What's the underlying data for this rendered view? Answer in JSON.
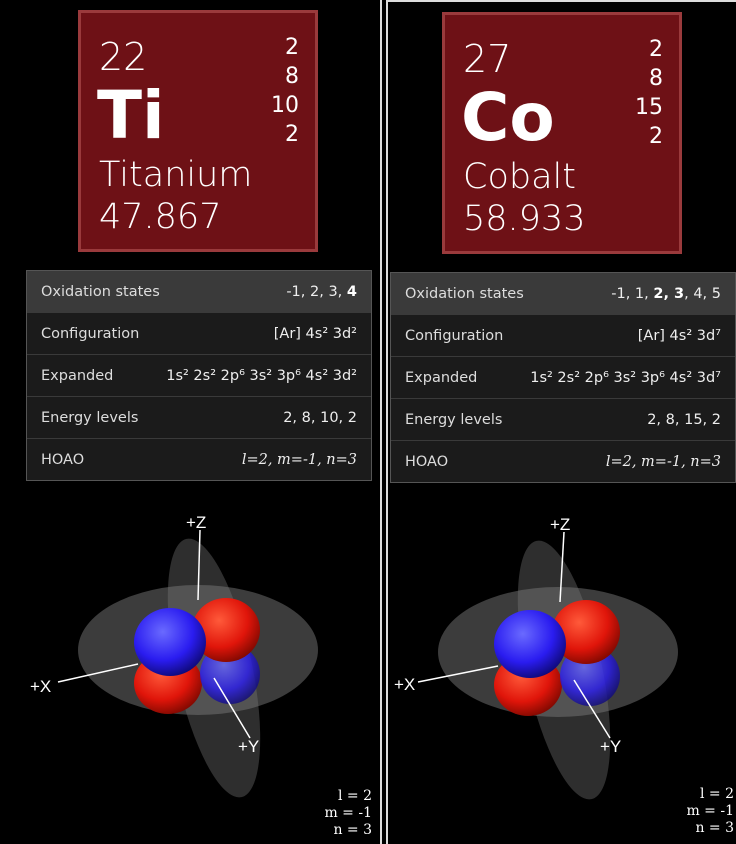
{
  "panels": [
    {
      "atomic_number": "22",
      "symbol": "Ti",
      "name": "Titanium",
      "mass": "47.867",
      "shells": [
        "2",
        "8",
        "10",
        "2"
      ],
      "rows": {
        "oxidation": {
          "label": "Oxidation states",
          "value_plain": "-1, 2, 3, ",
          "value_bold": "4",
          "value_tail": ""
        },
        "configuration": {
          "label": "Configuration",
          "value": "[Ar] 4s² 3d²"
        },
        "expanded": {
          "label": "Expanded",
          "value": "1s² 2s² 2p⁶ 3s² 3p⁶ 4s² 3d²"
        },
        "energy": {
          "label": "Energy levels",
          "value": "2, 8, 10, 2"
        },
        "hoao": {
          "label": "HOAO",
          "value": "l=2, m=-1, n=3"
        }
      },
      "axes": {
        "z": "+Z",
        "x": "+X",
        "y": "+Y"
      },
      "quantum": {
        "l": "l = 2",
        "m": "m = -1",
        "n": "n = 3"
      }
    },
    {
      "atomic_number": "27",
      "symbol": "Co",
      "name": "Cobalt",
      "mass": "58.933",
      "shells": [
        "2",
        "8",
        "15",
        "2"
      ],
      "rows": {
        "oxidation": {
          "label": "Oxidation states",
          "value_plain": "-1, 1, ",
          "value_bold": "2, 3",
          "value_tail": ", 4, 5"
        },
        "configuration": {
          "label": "Configuration",
          "value": "[Ar] 4s² 3d⁷"
        },
        "expanded": {
          "label": "Expanded",
          "value": "1s² 2s² 2p⁶ 3s² 3p⁶ 4s² 3d⁷"
        },
        "energy": {
          "label": "Energy levels",
          "value": "2, 8, 15, 2"
        },
        "hoao": {
          "label": "HOAO",
          "value": "l=2, m=-1, n=3"
        }
      },
      "axes": {
        "z": "+Z",
        "x": "+X",
        "y": "+Y"
      },
      "quantum": {
        "l": "l = 2",
        "m": "m = -1",
        "n": "n = 3"
      }
    }
  ],
  "colors": {
    "tile": "#6e1116",
    "lobe_red": "#e0150a",
    "lobe_blue": "#2a1cf0"
  }
}
